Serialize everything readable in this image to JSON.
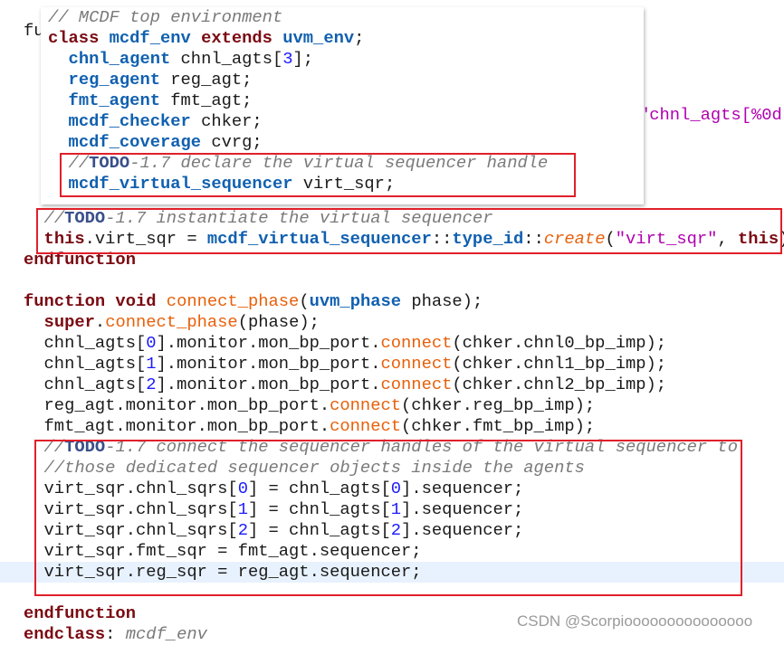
{
  "colors": {
    "keyword": "#7a0a12",
    "type": "#1060b0",
    "comment": "#7a7a7a",
    "method": "#e8600a",
    "string": "#b000b0",
    "number": "#1a1aff",
    "highlight": "#e8f2fe",
    "box": "#e0202a"
  },
  "tooltip": {
    "lines": [
      [
        [
          "c",
          "// MCDF top environment"
        ]
      ],
      [
        [
          "k",
          "class "
        ],
        [
          "t",
          "mcdf_env "
        ],
        [
          "k",
          "extends "
        ],
        [
          "t",
          "uvm_env"
        ],
        [
          "p",
          ";"
        ]
      ],
      [
        [
          "p",
          "  "
        ],
        [
          "t",
          "chnl_agent "
        ],
        [
          "p",
          "chnl_agts["
        ],
        [
          "n",
          "3"
        ],
        [
          "p",
          "];"
        ]
      ],
      [
        [
          "p",
          "  "
        ],
        [
          "t",
          "reg_agent "
        ],
        [
          "p",
          "reg_agt;"
        ]
      ],
      [
        [
          "p",
          "  "
        ],
        [
          "t",
          "fmt_agent "
        ],
        [
          "p",
          "fmt_agt;"
        ]
      ],
      [
        [
          "p",
          "  "
        ],
        [
          "t",
          "mcdf_checker "
        ],
        [
          "p",
          "chker;"
        ]
      ],
      [
        [
          "p",
          "  "
        ],
        [
          "t",
          "mcdf_coverage "
        ],
        [
          "p",
          "cvrg;"
        ]
      ],
      [
        [
          "p",
          "  "
        ],
        [
          "c",
          "//"
        ],
        [
          "todo",
          "TODO"
        ],
        [
          "c",
          "-1.7 declare the virtual sequencer handle"
        ]
      ],
      [
        [
          "p",
          "  "
        ],
        [
          "t",
          "mcdf_virtual_sequencer "
        ],
        [
          "p",
          "virt_sqr;"
        ]
      ]
    ]
  },
  "background": {
    "fragment_left": "fu",
    "fragment_string": "\"chnl_agts[%0d"
  },
  "code": {
    "lines": [
      [
        [
          "p",
          "  "
        ],
        [
          "c",
          "//"
        ],
        [
          "todo",
          "TODO"
        ],
        [
          "c",
          "-1.7 instantiate the virtual sequencer"
        ]
      ],
      [
        [
          "p",
          "  "
        ],
        [
          "k",
          "this"
        ],
        [
          "p",
          ".virt_sqr = "
        ],
        [
          "t",
          "mcdf_virtual_sequencer"
        ],
        [
          "p",
          "::"
        ],
        [
          "t",
          "type_id"
        ],
        [
          "p",
          "::"
        ],
        [
          "mi",
          "create"
        ],
        [
          "p",
          "("
        ],
        [
          "s",
          "\"virt_sqr\""
        ],
        [
          "p",
          ", "
        ],
        [
          "k",
          "this"
        ],
        [
          "p",
          ");"
        ]
      ],
      [
        [
          "k",
          "endfunction"
        ]
      ],
      [],
      [
        [
          "k",
          "function void "
        ],
        [
          "m",
          "connect_phase"
        ],
        [
          "p",
          "("
        ],
        [
          "t",
          "uvm_phase "
        ],
        [
          "p",
          "phase);"
        ]
      ],
      [
        [
          "p",
          "  "
        ],
        [
          "k",
          "super"
        ],
        [
          "p",
          "."
        ],
        [
          "m",
          "connect_phase"
        ],
        [
          "p",
          "(phase);"
        ]
      ],
      [
        [
          "p",
          "  chnl_agts["
        ],
        [
          "n",
          "0"
        ],
        [
          "p",
          "].monitor.mon_bp_port."
        ],
        [
          "m",
          "connect"
        ],
        [
          "p",
          "(chker.chnl0_bp_imp);"
        ]
      ],
      [
        [
          "p",
          "  chnl_agts["
        ],
        [
          "n",
          "1"
        ],
        [
          "p",
          "].monitor.mon_bp_port."
        ],
        [
          "m",
          "connect"
        ],
        [
          "p",
          "(chker.chnl1_bp_imp);"
        ]
      ],
      [
        [
          "p",
          "  chnl_agts["
        ],
        [
          "n",
          "2"
        ],
        [
          "p",
          "].monitor.mon_bp_port."
        ],
        [
          "m",
          "connect"
        ],
        [
          "p",
          "(chker.chnl2_bp_imp);"
        ]
      ],
      [
        [
          "p",
          "  reg_agt.monitor.mon_bp_port."
        ],
        [
          "m",
          "connect"
        ],
        [
          "p",
          "(chker.reg_bp_imp);"
        ]
      ],
      [
        [
          "p",
          "  fmt_agt.monitor.mon_bp_port."
        ],
        [
          "m",
          "connect"
        ],
        [
          "p",
          "(chker.fmt_bp_imp);"
        ]
      ],
      [
        [
          "p",
          "  "
        ],
        [
          "c",
          "//"
        ],
        [
          "todo",
          "TODO"
        ],
        [
          "c",
          "-1.7 connect the sequencer handles of the virtual sequencer to"
        ]
      ],
      [
        [
          "p",
          "  "
        ],
        [
          "c",
          "//those dedicated sequencer objects inside the agents"
        ]
      ],
      [
        [
          "p",
          "  virt_sqr.chnl_sqrs["
        ],
        [
          "n",
          "0"
        ],
        [
          "p",
          "] = chnl_agts["
        ],
        [
          "n",
          "0"
        ],
        [
          "p",
          "].sequencer;"
        ]
      ],
      [
        [
          "p",
          "  virt_sqr.chnl_sqrs["
        ],
        [
          "n",
          "1"
        ],
        [
          "p",
          "] = chnl_agts["
        ],
        [
          "n",
          "1"
        ],
        [
          "p",
          "].sequencer;"
        ]
      ],
      [
        [
          "p",
          "  virt_sqr.chnl_sqrs["
        ],
        [
          "n",
          "2"
        ],
        [
          "p",
          "] = chnl_agts["
        ],
        [
          "n",
          "2"
        ],
        [
          "p",
          "].sequencer;"
        ]
      ],
      [
        [
          "p",
          "  virt_sqr.fmt_sqr = fmt_agt.sequencer;"
        ]
      ],
      [
        [
          "p",
          "  virt_sqr.reg_sqr = reg_agt.sequencer;"
        ]
      ],
      [],
      [
        [
          "k",
          "endfunction"
        ]
      ],
      [
        [
          "k",
          "endclass"
        ],
        [
          "p",
          ": "
        ],
        [
          "c",
          "mcdf_env"
        ]
      ]
    ]
  },
  "watermark": "CSDN @Scorpiooooooooooooooo"
}
